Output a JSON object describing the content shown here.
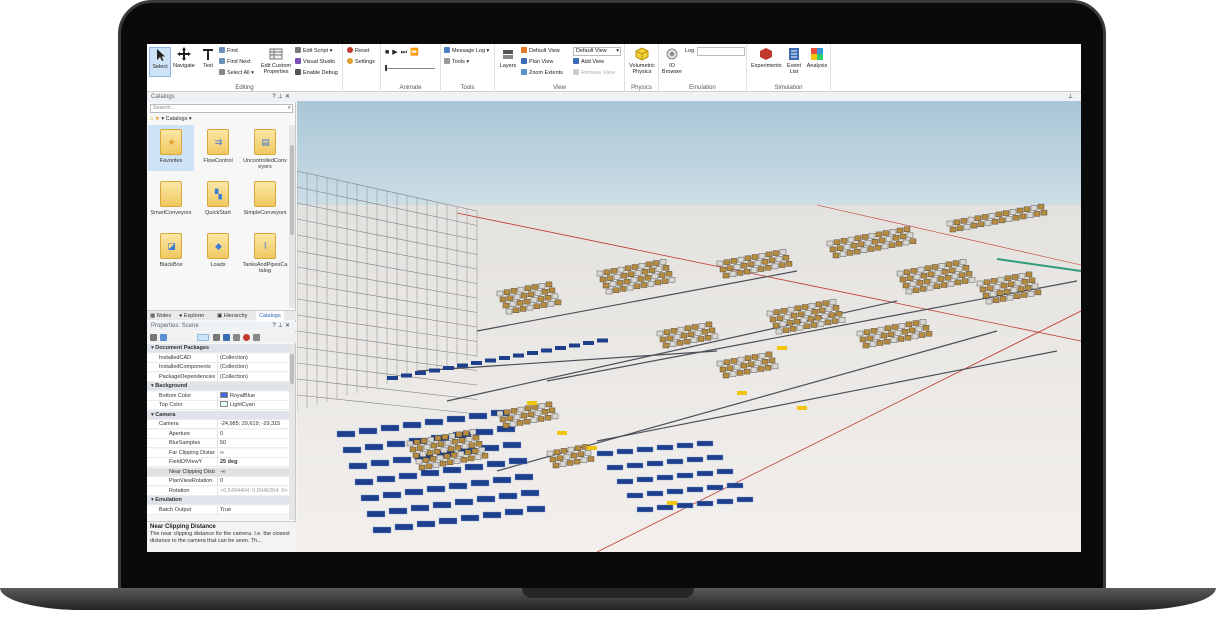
{
  "ribbon": {
    "groups": {
      "editing": "Editing",
      "animate": "Animate",
      "tools": "Tools",
      "view": "View",
      "physics": "Physics",
      "emulation": "Emulation",
      "simulation": "Simulation"
    },
    "select": "Select",
    "navigate": "Navigate",
    "text": "Text",
    "find": "Find",
    "find_next": "Find Next",
    "select_all": "Select All",
    "edit_custom_properties": "Edit Custom Properties",
    "edit_script": "Edit Script",
    "visual_studio": "Visual Studio",
    "enable_debug": "Enable Debug",
    "reset": "Reset",
    "settings": "Settings",
    "message_log": "Message Log",
    "tools_menu": "Tools",
    "layers": "Layers",
    "default_view": "Default View",
    "plan_view": "Plan View",
    "zoom_extents": "Zoom Extents",
    "view_select": "Default View",
    "add_view": "Add View",
    "remove_view": "Remove View",
    "volumetric_physics": "Volumetric Physics",
    "io_browser": "IO Browser",
    "log_label": "Log",
    "experiments": "Experiments",
    "event_list": "Event List",
    "analysis": "Analysis"
  },
  "catalogs": {
    "title": "Catalogs",
    "search_placeholder": "Search...",
    "breadcrumb": "Catalogs",
    "items": [
      {
        "label": "Favorites",
        "icon": "star-icon"
      },
      {
        "label": "FlowControl",
        "icon": "flow-icon"
      },
      {
        "label": "UncontrolledConveyors",
        "icon": "conveyor-icon"
      },
      {
        "label": "SmartConveyors",
        "icon": "folder-icon"
      },
      {
        "label": "QuickStart",
        "icon": "quickstart-icon"
      },
      {
        "label": "SimpleConveyors",
        "icon": "folder-icon"
      },
      {
        "label": "BlackBox",
        "icon": "blackbox-icon"
      },
      {
        "label": "Loads",
        "icon": "loads-icon"
      },
      {
        "label": "TanksAndPipesCatalog",
        "icon": "pipe-icon"
      }
    ]
  },
  "tabs": [
    "Notes",
    "Explorer",
    "Hierarchy",
    "Catalogs"
  ],
  "properties": {
    "title": "Properties: Scene",
    "rows": [
      {
        "type": "cat",
        "key": "Document Packages"
      },
      {
        "type": "row",
        "key": "InstalledCAD",
        "value": "(Collection)"
      },
      {
        "type": "row",
        "key": "InstalledComponents",
        "value": "(Collection)"
      },
      {
        "type": "row",
        "key": "PackageDependencies",
        "value": "(Collection)"
      },
      {
        "type": "cat",
        "key": "Background"
      },
      {
        "type": "row",
        "key": "Bottom Color",
        "value": "RoyalBlue",
        "swatch": "#4169e1"
      },
      {
        "type": "row",
        "key": "Top Color",
        "value": "LightCyan",
        "swatch": "#e0ffff"
      },
      {
        "type": "cat",
        "key": "Camera"
      },
      {
        "type": "row",
        "key": "Camera",
        "value": "-24,985; 29,619; -29,315"
      },
      {
        "type": "sub",
        "key": "Aperture",
        "value": "0"
      },
      {
        "type": "sub",
        "key": "BlurSamples",
        "value": "50"
      },
      {
        "type": "sub",
        "key": "Far Clipping Distance",
        "value": "∞"
      },
      {
        "type": "sub",
        "key": "FieldOfViewY",
        "value": "25 deg",
        "bold": true
      },
      {
        "type": "sub",
        "key": "Near Clipping Distance",
        "value": "-∞",
        "hl": true
      },
      {
        "type": "sub",
        "key": "PlanViewRotation",
        "value": "0"
      },
      {
        "type": "sub",
        "key": "Rotation",
        "value": "<0,5494404; 0,6046264; 0>",
        "dim": true
      },
      {
        "type": "cat",
        "key": "Emulation"
      },
      {
        "type": "row",
        "key": "Batch Output",
        "value": "True"
      }
    ]
  },
  "description": {
    "title": "Near Clipping Distance",
    "text": "The near clipping distance for the camera. I.e. the closest distance to the camera that can be seen. Th..."
  },
  "colors": {
    "accent": "#2a63b8",
    "sky": "#b9d1df",
    "floor": "#e8e4e0",
    "conveyor_blue": "#1d3f8c",
    "box": "#c8a356"
  }
}
